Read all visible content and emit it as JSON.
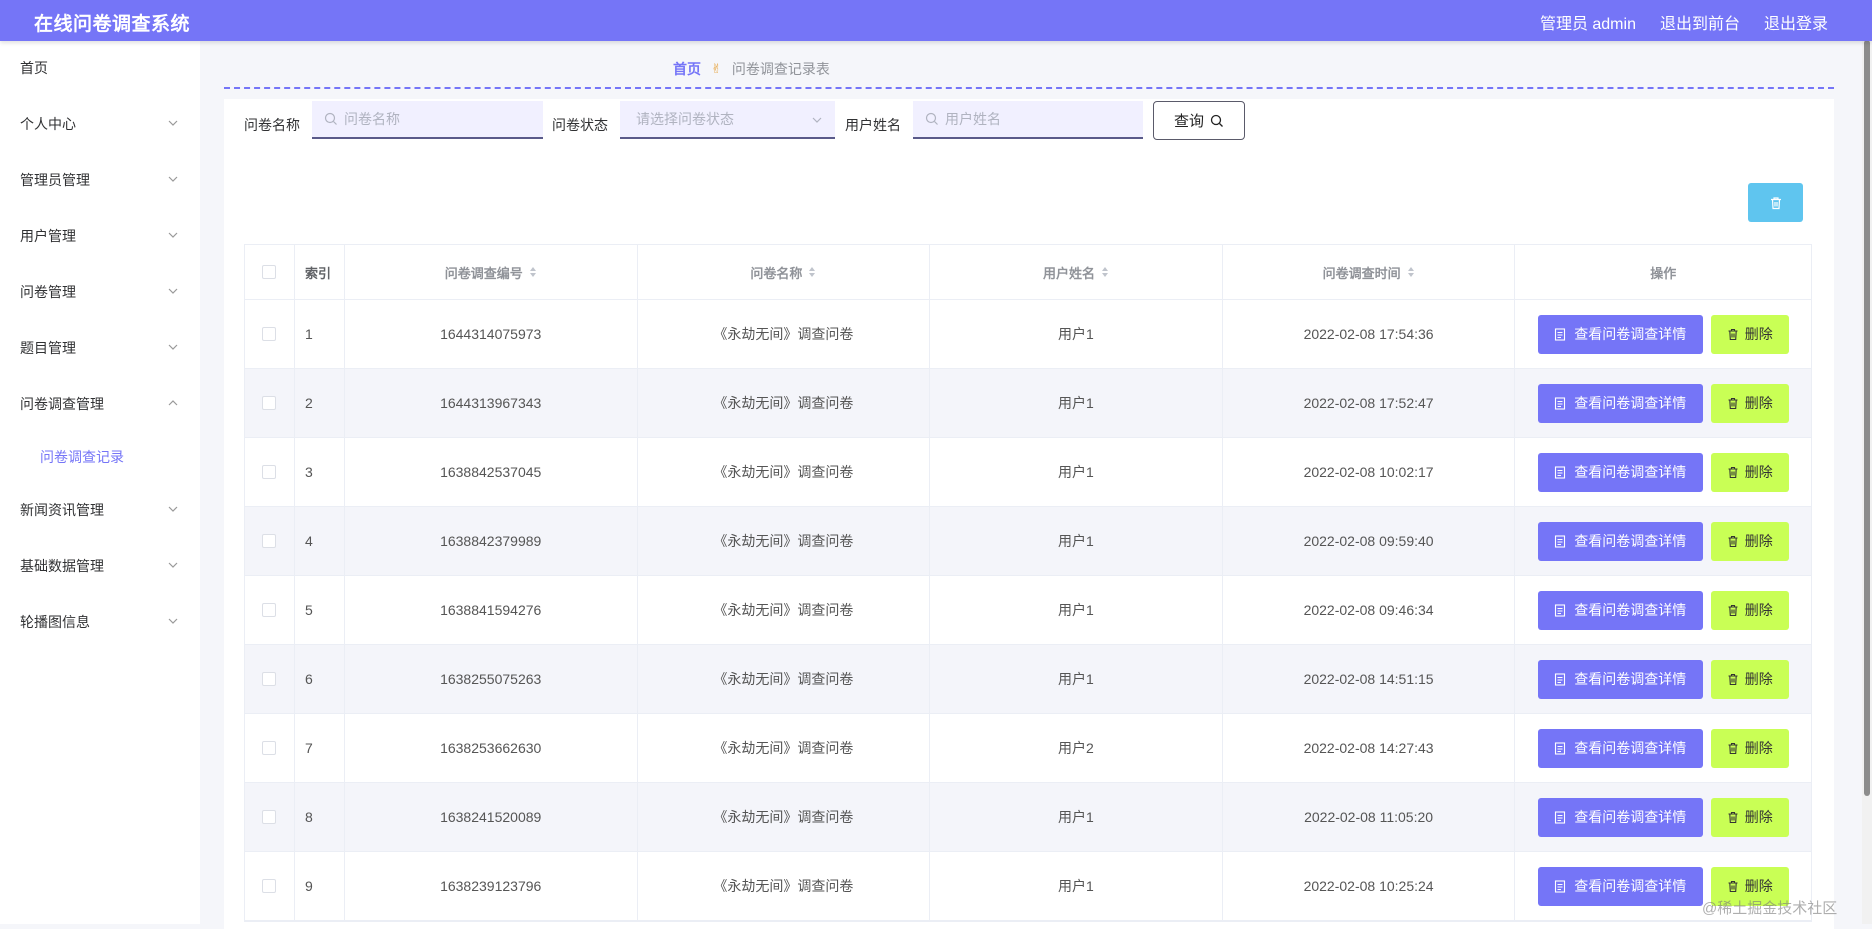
{
  "header": {
    "app_title": "在线问卷调查系统",
    "admin_label": "管理员 admin",
    "back_to_front": "退出到前台",
    "logout": "退出登录"
  },
  "sidebar": {
    "items": [
      {
        "label": "首页",
        "expandable": false
      },
      {
        "label": "个人中心",
        "expandable": true
      },
      {
        "label": "管理员管理",
        "expandable": true
      },
      {
        "label": "用户管理",
        "expandable": true
      },
      {
        "label": "问卷管理",
        "expandable": true
      },
      {
        "label": "题目管理",
        "expandable": true
      },
      {
        "label": "问卷调查管理",
        "expandable": true,
        "expanded": true
      },
      {
        "label": "问卷调查记录",
        "sub": true
      },
      {
        "label": "新闻资讯管理",
        "expandable": true
      },
      {
        "label": "基础数据管理",
        "expandable": true
      },
      {
        "label": "轮播图信息",
        "expandable": true
      }
    ]
  },
  "breadcrumb": {
    "home": "首页",
    "separator": "✌",
    "current": "问卷调查记录表"
  },
  "search": {
    "name_label": "问卷名称",
    "name_placeholder": "问卷名称",
    "status_label": "问卷状态",
    "status_placeholder": "请选择问卷状态",
    "user_label": "用户姓名",
    "user_placeholder": "用户姓名",
    "query_button": "查询"
  },
  "table": {
    "columns": [
      "索引",
      "问卷调查编号",
      "问卷名称",
      "用户姓名",
      "问卷调查时间",
      "操作"
    ],
    "view_button": "查看问卷调查详情",
    "delete_button": "删除",
    "rows": [
      {
        "idx": "1",
        "code": "1644314075973",
        "name": "《永劫无间》调查问卷",
        "user": "用户1",
        "time": "2022-02-08 17:54:36"
      },
      {
        "idx": "2",
        "code": "1644313967343",
        "name": "《永劫无间》调查问卷",
        "user": "用户1",
        "time": "2022-02-08 17:52:47"
      },
      {
        "idx": "3",
        "code": "1638842537045",
        "name": "《永劫无间》调查问卷",
        "user": "用户1",
        "time": "2022-02-08 10:02:17"
      },
      {
        "idx": "4",
        "code": "1638842379989",
        "name": "《永劫无间》调查问卷",
        "user": "用户1",
        "time": "2022-02-08 09:59:40"
      },
      {
        "idx": "5",
        "code": "1638841594276",
        "name": "《永劫无间》调查问卷",
        "user": "用户1",
        "time": "2022-02-08 09:46:34"
      },
      {
        "idx": "6",
        "code": "1638255075263",
        "name": "《永劫无间》调查问卷",
        "user": "用户1",
        "time": "2022-02-08 14:51:15"
      },
      {
        "idx": "7",
        "code": "1638253662630",
        "name": "《永劫无间》调查问卷",
        "user": "用户2",
        "time": "2022-02-08 14:27:43"
      },
      {
        "idx": "8",
        "code": "1638241520089",
        "name": "《永劫无间》调查问卷",
        "user": "用户1",
        "time": "2022-02-08 11:05:20"
      },
      {
        "idx": "9",
        "code": "1638239123796",
        "name": "《永劫无间》调查问卷",
        "user": "用户1",
        "time": "2022-02-08 10:25:24"
      }
    ]
  },
  "watermark": "@稀土掘金技术社区",
  "colors": {
    "primary": "#7575f7",
    "delete": "#c9ff55",
    "batch_delete": "#5fc5ef"
  }
}
